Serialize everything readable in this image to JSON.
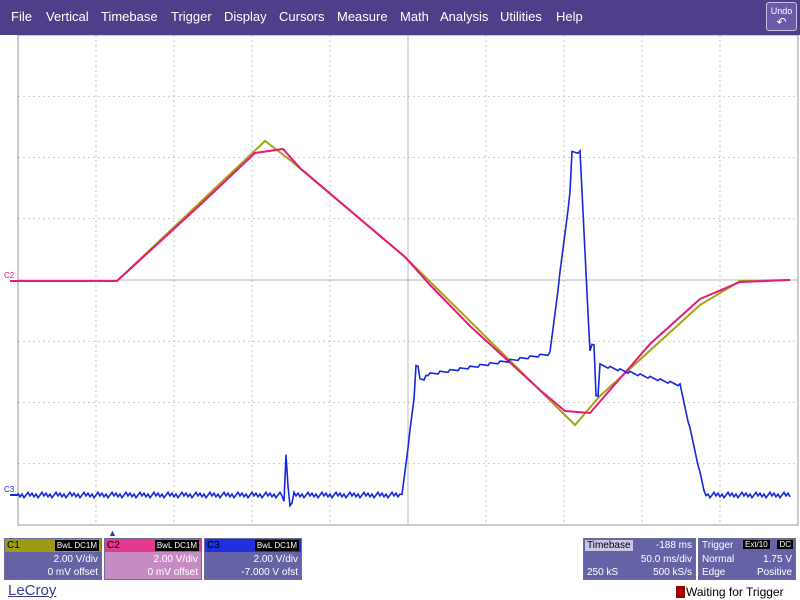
{
  "menu": [
    "File",
    "Vertical",
    "Timebase",
    "Trigger",
    "Display",
    "Cursors",
    "Measure",
    "Math",
    "Analysis",
    "Utilities",
    "Help"
  ],
  "undo_label": "Undo",
  "channels": [
    {
      "name": "C1",
      "tags": "BwL DC1M",
      "scale": "2.00 V/div",
      "offset": "0 mV offset",
      "color": "#a3a30e"
    },
    {
      "name": "C2",
      "tags": "BwL DC1M",
      "scale": "2.00 V/div",
      "offset": "0 mV offset",
      "color": "#e5197f"
    },
    {
      "name": "C3",
      "tags": "BwL DC1M",
      "scale": "2.00 V/div",
      "offset": "-7.000 V ofst",
      "color": "#1428e0"
    }
  ],
  "trace_labels": {
    "c2": "C2",
    "c3": "C3"
  },
  "timebase": {
    "label": "Timebase",
    "delay": "-188 ms",
    "scale": "50.0 ms/div",
    "samples": "250 kS",
    "rate": "500 kS/s"
  },
  "trigger": {
    "label": "Trigger",
    "source": "Ext/10",
    "coupling": "DC",
    "mode": "Normal",
    "level": "1.75 V",
    "type": "Edge",
    "slope": "Positive"
  },
  "logo": "LeCroy",
  "status": "Waiting for Trigger",
  "colors": {
    "menu_bg": "#4f3f8b",
    "grid": "#b9b9b9",
    "status_led": "#a00000"
  }
}
